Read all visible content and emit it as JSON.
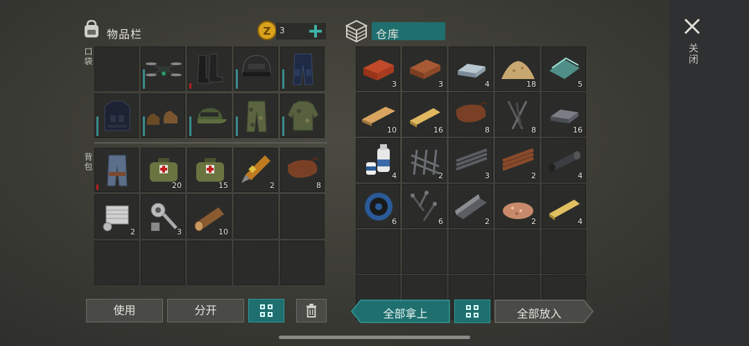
{
  "inventory": {
    "title": "物品栏",
    "coins": "3",
    "pockets_label": "口袋",
    "backpack_label": "背包",
    "pocket_slots": [
      {
        "icon": "empty",
        "count": ""
      },
      {
        "icon": "drone-icon",
        "count": ""
      },
      {
        "icon": "boots-icon",
        "count": ""
      },
      {
        "icon": "helmet-icon",
        "count": ""
      },
      {
        "icon": "pants-icon",
        "count": ""
      },
      {
        "icon": "vest-icon",
        "count": ""
      },
      {
        "icon": "shoes-icon",
        "count": ""
      },
      {
        "icon": "cap-icon",
        "count": ""
      },
      {
        "icon": "camo-pants-icon",
        "count": ""
      },
      {
        "icon": "camo-jacket-icon",
        "count": ""
      }
    ],
    "backpack_slots": [
      {
        "icon": "jeans-icon",
        "count": ""
      },
      {
        "icon": "medkit-icon",
        "count": "20"
      },
      {
        "icon": "medkit-icon",
        "count": "15"
      },
      {
        "icon": "syringe-icon",
        "count": "2"
      },
      {
        "icon": "leather-icon",
        "count": "8"
      },
      {
        "icon": "engine-part-icon",
        "count": "2"
      },
      {
        "icon": "mechanism-icon",
        "count": "3"
      },
      {
        "icon": "log-icon",
        "count": "10"
      },
      {
        "icon": "empty",
        "count": ""
      },
      {
        "icon": "empty",
        "count": ""
      },
      {
        "icon": "empty",
        "count": ""
      },
      {
        "icon": "empty",
        "count": ""
      },
      {
        "icon": "empty",
        "count": ""
      },
      {
        "icon": "empty",
        "count": ""
      },
      {
        "icon": "empty",
        "count": ""
      }
    ]
  },
  "storage": {
    "title": "仓库",
    "slots": [
      {
        "icon": "brick-icon",
        "count": "3"
      },
      {
        "icon": "clay-brick-icon",
        "count": "3"
      },
      {
        "icon": "iron-ingot-icon",
        "count": "4"
      },
      {
        "icon": "sand-icon",
        "count": "18"
      },
      {
        "icon": "glass-icon",
        "count": "5"
      },
      {
        "icon": "plank-icon",
        "count": "10"
      },
      {
        "icon": "board-icon",
        "count": "16"
      },
      {
        "icon": "leather-icon",
        "count": "8"
      },
      {
        "icon": "nails-icon",
        "count": "8"
      },
      {
        "icon": "steel-ingot-icon",
        "count": "16"
      },
      {
        "icon": "glue-icon",
        "count": "4"
      },
      {
        "icon": "rebar-mesh-icon",
        "count": "2"
      },
      {
        "icon": "rebar-icon",
        "count": "3"
      },
      {
        "icon": "wood-slats-icon",
        "count": "2"
      },
      {
        "icon": "pipe-icon",
        "count": "4"
      },
      {
        "icon": "wire-spool-icon",
        "count": "6"
      },
      {
        "icon": "screws-icon",
        "count": "6"
      },
      {
        "icon": "metal-profile-icon",
        "count": "2"
      },
      {
        "icon": "sawdust-icon",
        "count": "2"
      },
      {
        "icon": "beam-icon",
        "count": "4"
      },
      {
        "icon": "empty",
        "count": ""
      },
      {
        "icon": "empty",
        "count": ""
      },
      {
        "icon": "empty",
        "count": ""
      },
      {
        "icon": "empty",
        "count": ""
      },
      {
        "icon": "empty",
        "count": ""
      },
      {
        "icon": "empty",
        "count": ""
      },
      {
        "icon": "empty",
        "count": ""
      },
      {
        "icon": "empty",
        "count": ""
      },
      {
        "icon": "empty",
        "count": ""
      },
      {
        "icon": "empty",
        "count": ""
      }
    ]
  },
  "actions": {
    "use": "使用",
    "split": "分开",
    "take_all": "全部拿上",
    "put_all": "全部放入"
  },
  "close_label": "关闭",
  "colors": {
    "accent": "#1f6f6f",
    "accent_border": "#2f9a98",
    "coin": "#d8a21c"
  }
}
